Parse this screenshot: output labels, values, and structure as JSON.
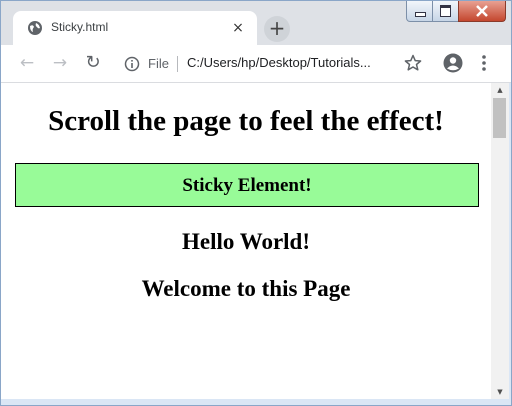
{
  "browser": {
    "tab": {
      "title": "Sticky.html",
      "close_glyph": "×"
    },
    "new_tab_glyph": "+",
    "toolbar": {
      "back_glyph": "←",
      "forward_glyph": "→",
      "reload_glyph": "↻",
      "file_label": "File",
      "url": "C:/Users/hp/Desktop/Tutorials..."
    },
    "icons": [
      "globe-icon",
      "info-icon",
      "star-icon",
      "account-icon",
      "menu-icon"
    ]
  },
  "page": {
    "heading": "Scroll the page to feel the effect!",
    "sticky_label": "Sticky Element!",
    "line1": "Hello World!",
    "line2": "Welcome to this Page",
    "sticky_color": "#98fb98"
  },
  "scrollbar": {
    "up_glyph": "▲",
    "down_glyph": "▼"
  }
}
